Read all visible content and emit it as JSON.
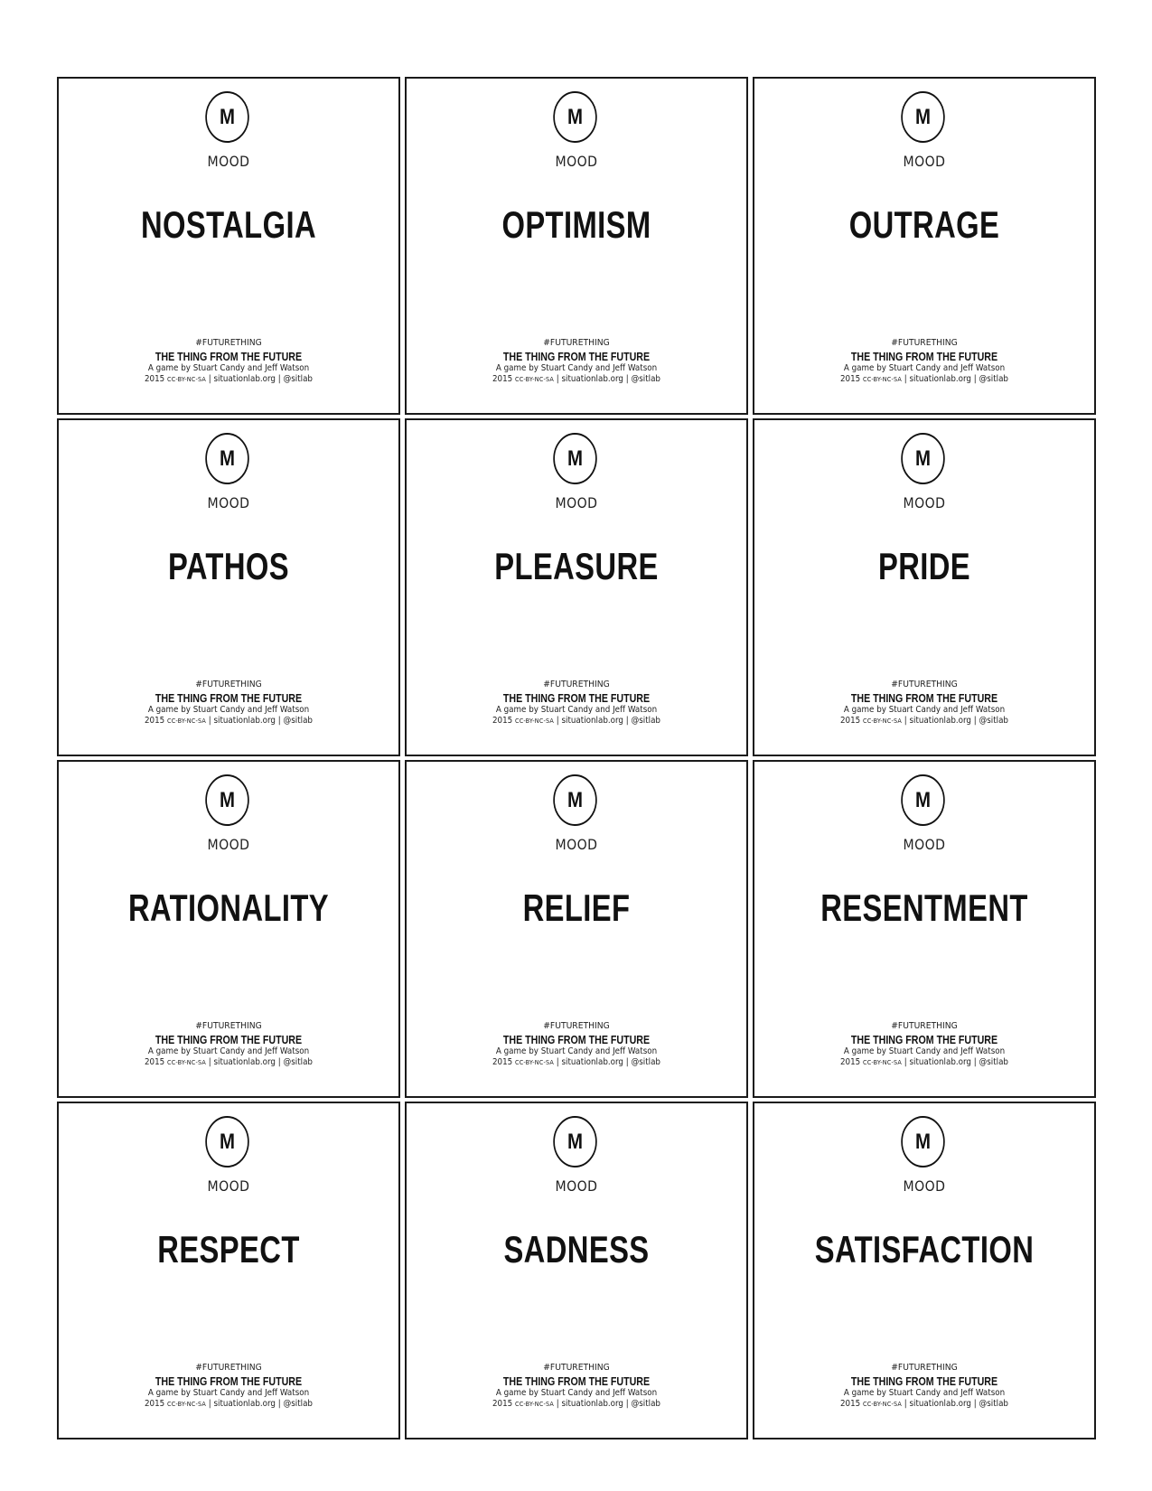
{
  "card_common": {
    "badge_letter": "M",
    "category": "MOOD",
    "hashtag": "#FUTURETHING",
    "game_title": "THE THING FROM THE FUTURE",
    "credit": "A game by Stuart Candy and Jeff Watson",
    "year": "2015",
    "license": "CC-BY-NC-SA",
    "separator": "|",
    "site": "situationlab.org",
    "handle": "@sitlab"
  },
  "cards": [
    {
      "word": "NOSTALGIA"
    },
    {
      "word": "OPTIMISM"
    },
    {
      "word": "OUTRAGE"
    },
    {
      "word": "PATHOS"
    },
    {
      "word": "PLEASURE"
    },
    {
      "word": "PRIDE"
    },
    {
      "word": "RATIONALITY"
    },
    {
      "word": "RELIEF"
    },
    {
      "word": "RESENTMENT"
    },
    {
      "word": "RESPECT"
    },
    {
      "word": "SADNESS"
    },
    {
      "word": "SATISFACTION"
    }
  ]
}
